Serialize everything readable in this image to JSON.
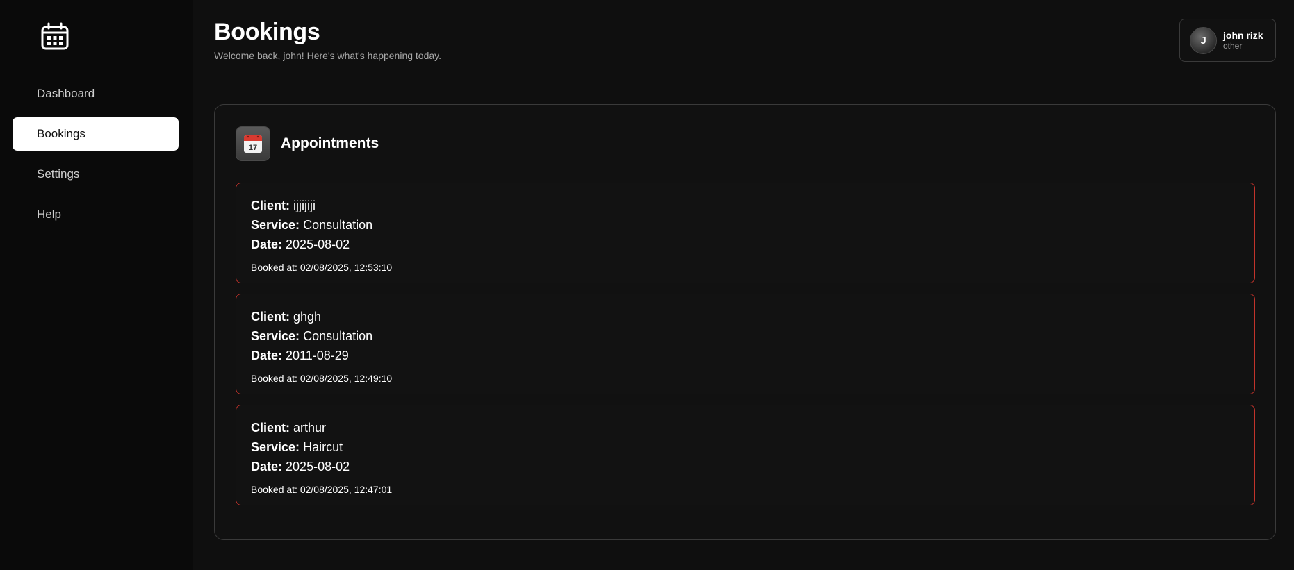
{
  "sidebar": {
    "logo_icon": "calendar-icon",
    "items": [
      {
        "label": "Dashboard",
        "active": false
      },
      {
        "label": "Bookings",
        "active": true
      },
      {
        "label": "Settings",
        "active": false
      },
      {
        "label": "Help",
        "active": false
      }
    ]
  },
  "header": {
    "title": "Bookings",
    "subtitle": "Welcome back, john! Here's what's happening today."
  },
  "user": {
    "initial": "J",
    "name": "john rizk",
    "role": "other"
  },
  "appointments": {
    "title": "Appointments",
    "icon": "calendar-17-icon",
    "icon_day": "17",
    "labels": {
      "client": "Client:",
      "service": "Service:",
      "date": "Date:",
      "booked_at": "Booked at:"
    },
    "items": [
      {
        "client": "ijjijiji",
        "service": "Consultation",
        "date": "2025-08-02",
        "booked_at": "02/08/2025, 12:53:10"
      },
      {
        "client": "ghgh",
        "service": "Consultation",
        "date": "2011-08-29",
        "booked_at": "02/08/2025, 12:49:10"
      },
      {
        "client": "arthur",
        "service": "Haircut",
        "date": "2025-08-02",
        "booked_at": "02/08/2025, 12:47:01"
      }
    ]
  },
  "colors": {
    "background": "#0f0f0f",
    "booking_border": "#c2332b",
    "active_nav_bg": "#ffffff"
  }
}
